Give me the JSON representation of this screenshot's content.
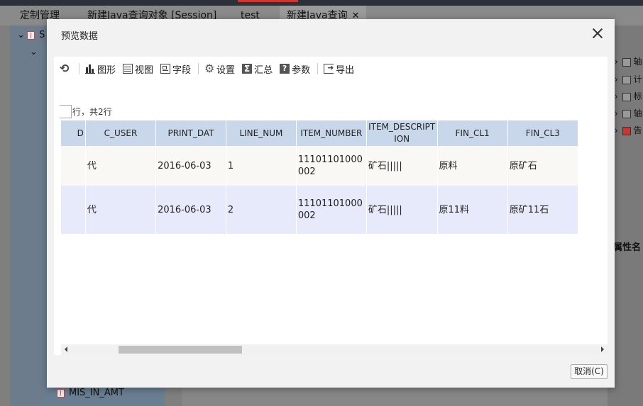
{
  "app": {
    "tabs": [
      {
        "label": "定制管理",
        "active": false
      },
      {
        "label": "新建Java查询对象 [Session]",
        "active": false
      },
      {
        "label": "test",
        "active": false
      },
      {
        "label": "新建Java查询",
        "active": true,
        "closable": true
      }
    ],
    "tree": {
      "root_label": "S",
      "bottom_item": "MIS_IN_AMT"
    },
    "right_panel": {
      "items": [
        "轴",
        "计",
        "标",
        "轴",
        "告"
      ],
      "property_label": "属性名"
    }
  },
  "dialog": {
    "title": "预览数据",
    "toolbar": {
      "refresh_icon": "refresh-icon",
      "chart_label": "图形",
      "view_label": "视图",
      "field_label": "字段",
      "settings_label": "设置",
      "summary_label": "汇总",
      "param_label": "参数",
      "export_label": "导出"
    },
    "row_info": "行，共2行",
    "table": {
      "columns": [
        "D",
        "C_USER",
        "PRINT_DAT",
        "LINE_NUM",
        "ITEM_NUMBER",
        "ITEM_DESCRIPTION",
        "FIN_CL1",
        "FIN_CL3"
      ],
      "rows": [
        [
          "",
          "代",
          "2016-06-03",
          "1",
          "11101101000002",
          "矿石|||||",
          "原料",
          "原矿石"
        ],
        [
          "",
          "代",
          "2016-06-03",
          "2",
          "11101101000002",
          "矿石|||||",
          "原11料",
          "原矿11石"
        ]
      ]
    },
    "cancel_label": "取消(C)"
  }
}
